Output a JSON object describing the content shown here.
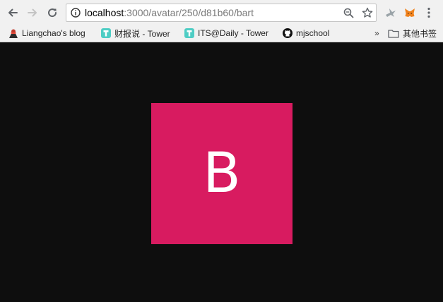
{
  "browser": {
    "url_host": "localhost",
    "url_path": ":3000/avatar/250/d81b60/bart",
    "bookmarks": [
      {
        "label": "Liangchao's blog",
        "icon": "blog-favicon"
      },
      {
        "label": "财报说 - Tower",
        "icon": "tower-favicon"
      },
      {
        "label": "ITS@Daily - Tower",
        "icon": "tower-favicon"
      },
      {
        "label": "mjschool",
        "icon": "github-favicon"
      }
    ],
    "overflow_label": "»",
    "other_bookmarks_label": "其他书签"
  },
  "avatar": {
    "letter": "B",
    "background_color": "#d81b60",
    "text_color": "#ffffff"
  },
  "colors": {
    "page_background": "#0e0e0e",
    "chrome_background": "#f1f1f1"
  }
}
